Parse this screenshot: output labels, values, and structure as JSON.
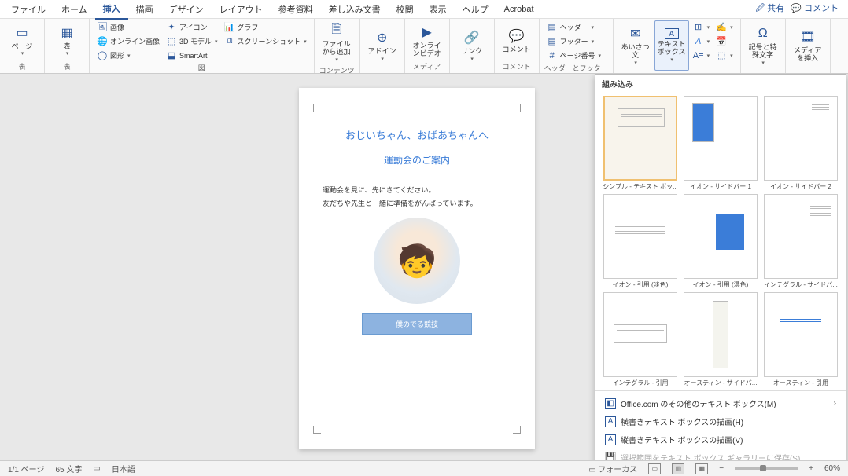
{
  "tabs": [
    "ファイル",
    "ホーム",
    "挿入",
    "描画",
    "デザイン",
    "レイアウト",
    "参考資料",
    "差し込み文書",
    "校閲",
    "表示",
    "ヘルプ",
    "Acrobat"
  ],
  "active_tab": 2,
  "top_right": {
    "share": "共有",
    "comment": "コメント"
  },
  "ribbon": {
    "g1": {
      "pages": "ページ",
      "label": "表"
    },
    "g2": {
      "table": "表",
      "label": "表"
    },
    "g3": {
      "pic": "画像",
      "online_pic": "オンライン画像",
      "shape": "図形",
      "icons": "アイコン",
      "model3d": "3D モデル",
      "smartart": "SmartArt",
      "chart": "グラフ",
      "screenshot": "スクリーンショット",
      "label": "図"
    },
    "g4": {
      "from_file": "ファイルから追加",
      "label": "コンテンツ"
    },
    "g5": {
      "addin": "アドイン",
      "label": ""
    },
    "g6": {
      "online_video": "オンラインビデオ",
      "label": "メディア"
    },
    "g7": {
      "link": "リンク",
      "label": ""
    },
    "g8": {
      "comment": "コメント",
      "label": "コメント"
    },
    "g9": {
      "header": "ヘッダー",
      "footer": "フッター",
      "page_num": "ページ番号",
      "label": "ヘッダーとフッター"
    },
    "g10": {
      "greeting": "あいさつ文",
      "textbox": "テキストボックス",
      "label": ""
    },
    "g11": {
      "symbol": "記号と特殊文字",
      "label": ""
    },
    "g12": {
      "media": "メディアを挿入",
      "label": ""
    }
  },
  "gallery": {
    "title": "組み込み",
    "items": [
      {
        "cap": "シンプル - テキスト ボッ..."
      },
      {
        "cap": "イオン - サイドバー 1"
      },
      {
        "cap": "イオン - サイドバー 2"
      },
      {
        "cap": "イオン - 引用 (淡色)"
      },
      {
        "cap": "イオン - 引用 (濃色)"
      },
      {
        "cap": "インテグラル - サイドバ..."
      },
      {
        "cap": "インテグラル - 引用"
      },
      {
        "cap": "オースティン - サイドバ..."
      },
      {
        "cap": "オースティン - 引用"
      }
    ],
    "footer": {
      "more": "Office.com のその他のテキスト ボックス(M)",
      "horiz": "横書きテキスト ボックスの描画(H)",
      "vert": "縦書きテキスト ボックスの描画(V)",
      "save": "選択範囲をテキスト ボックス ギャラリーに保存(S)"
    }
  },
  "doc": {
    "title": "おじいちゃん、おばあちゃんへ",
    "subtitle": "運動会のご案内",
    "p1": "運動会を見に、先にきてください。",
    "p2": "友だちや先生と一緒に準備をがんばっています。",
    "button": "僕のでる競技"
  },
  "status": {
    "page": "1/1 ページ",
    "words": "65 文字",
    "lang": "日本語",
    "focus": "フォーカス",
    "zoom": "60%"
  }
}
